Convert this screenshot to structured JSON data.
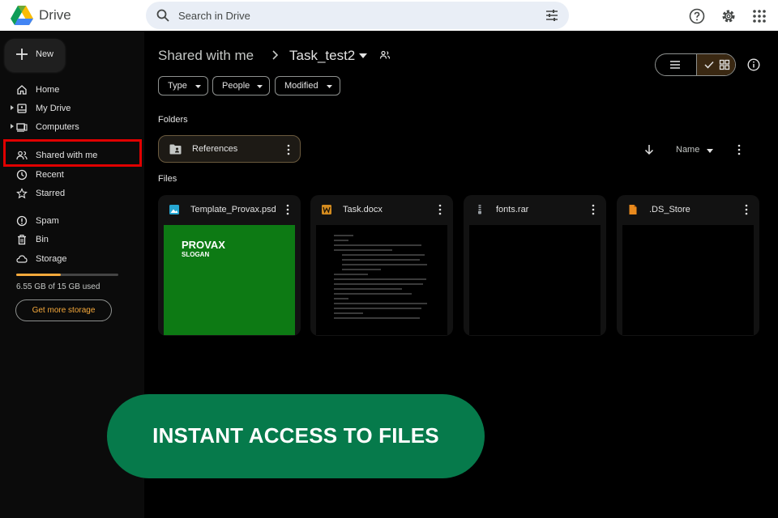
{
  "app": {
    "title": "Drive"
  },
  "search": {
    "placeholder": "Search in Drive"
  },
  "topbar": {
    "icons": [
      "help-icon",
      "settings-icon",
      "apps-grid-icon"
    ]
  },
  "sidebar": {
    "new_label": "New",
    "items": [
      {
        "label": "Home",
        "icon": "home-icon"
      },
      {
        "label": "My Drive",
        "icon": "my-drive-icon"
      },
      {
        "label": "Computers",
        "icon": "computers-icon"
      },
      {
        "label": "Shared with me",
        "icon": "shared-icon"
      },
      {
        "label": "Recent",
        "icon": "clock-icon"
      },
      {
        "label": "Starred",
        "icon": "star-icon"
      },
      {
        "label": "Spam",
        "icon": "spam-icon"
      },
      {
        "label": "Bin",
        "icon": "bin-icon"
      },
      {
        "label": "Storage",
        "icon": "cloud-icon"
      }
    ],
    "storage": {
      "used_text": "6.55 GB of 15 GB used",
      "used_fraction": 0.437
    },
    "get_more_label": "Get more storage"
  },
  "breadcrumb": {
    "root": "Shared with me",
    "current": "Task_test2"
  },
  "filters": [
    "Type",
    "People",
    "Modified"
  ],
  "sections": {
    "folders": "Folders",
    "files": "Files"
  },
  "folders": [
    {
      "name": "References"
    }
  ],
  "sort": {
    "label": "Name"
  },
  "files": [
    {
      "name": "Template_Provax.psd",
      "thumb_brand": "PROVAX",
      "thumb_slogan": "SLOGAN"
    },
    {
      "name": "Task.docx"
    },
    {
      "name": "fonts.rar"
    },
    {
      "name": ".DS_Store"
    }
  ],
  "banner": {
    "text": "INSTANT ACCESS TO FILES"
  },
  "colors": {
    "accent": "#f6a93b",
    "banner": "#067a4b",
    "highlight": "#e00000",
    "psd_thumb": "#0d7a14"
  }
}
